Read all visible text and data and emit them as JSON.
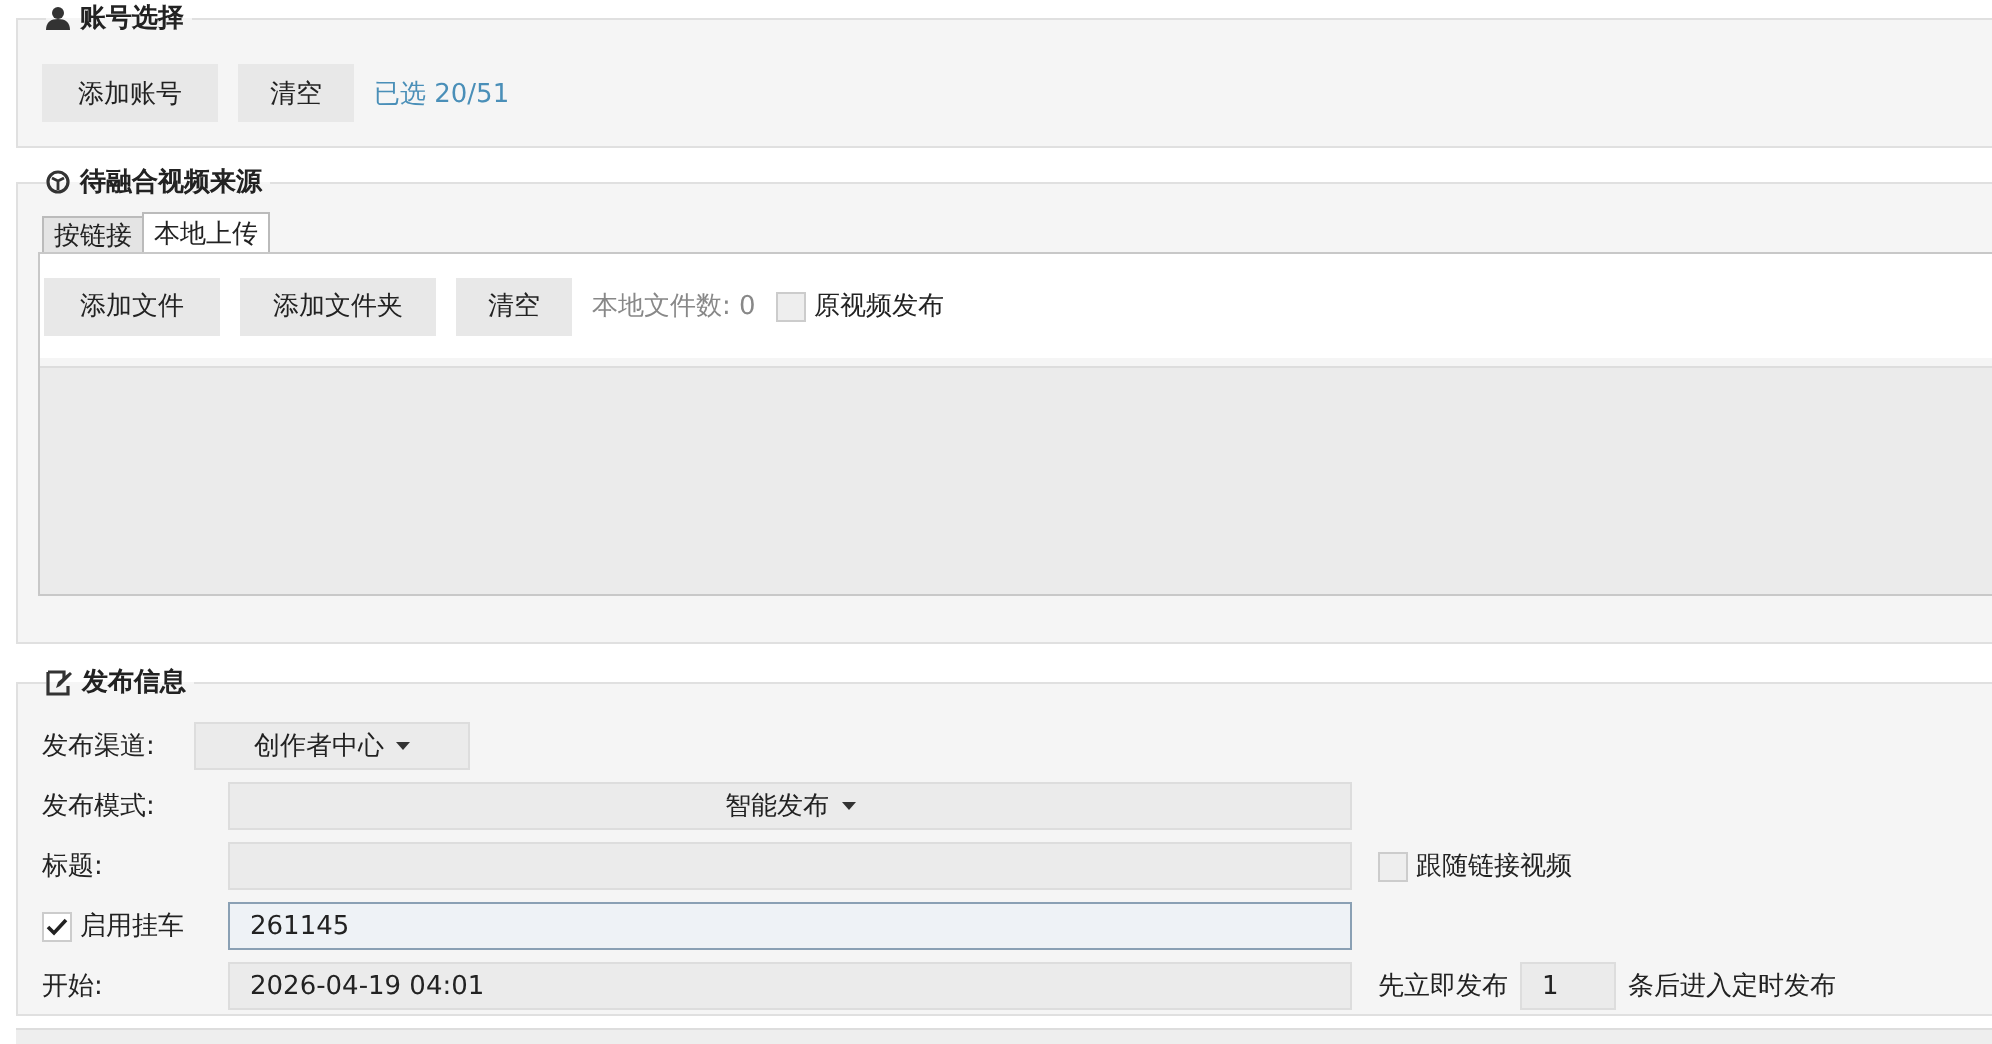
{
  "account_section": {
    "title": "账号选择",
    "buttons": [
      "添加账号",
      "清空"
    ],
    "selected_count": "已选 20/51"
  },
  "source_section": {
    "title": "待融合视频来源",
    "tabs": [
      {
        "label": "按链接",
        "selected": false
      },
      {
        "label": "本地上传",
        "selected": true
      }
    ],
    "buttons": [
      "添加文件",
      "添加文件夹",
      "清空"
    ],
    "file_count": "本地文件数: 0",
    "original_publish": {
      "label": "原视频发布",
      "checked": false
    }
  },
  "publish_section": {
    "title": "发布信息",
    "fields": [
      {
        "kind": "dropdown",
        "label": "发布渠道:",
        "value": "创作者中心"
      },
      {
        "kind": "wide-dropdown",
        "label": "发布模式:",
        "value": "智能发布"
      },
      {
        "kind": "text",
        "label": "标题:",
        "side": {
          "kind": "checkbox",
          "label": "跟随链接视频",
          "checked": false
        }
      },
      {
        "kind": "checkbox",
        "label": "启用挂车",
        "checked": true,
        "value": "261145",
        "focused": true
      },
      {
        "kind": "text",
        "label": "开始:",
        "value": "2026-04-19 04:01",
        "side": {
          "kind": "count",
          "before": "先立即发布",
          "value": "1",
          "after": "条后进入定时发布"
        }
      }
    ]
  }
}
